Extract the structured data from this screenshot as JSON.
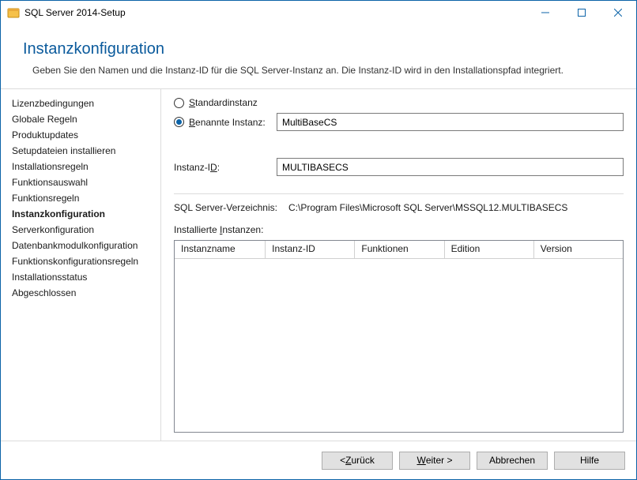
{
  "window": {
    "title": "SQL Server 2014-Setup"
  },
  "header": {
    "title": "Instanzkonfiguration",
    "subtitle": "Geben Sie den Namen und die Instanz-ID für die SQL Server-Instanz an. Die Instanz-ID wird in den Installationspfad integriert."
  },
  "sidebar": {
    "items": [
      "Lizenzbedingungen",
      "Globale Regeln",
      "Produktupdates",
      "Setupdateien installieren",
      "Installationsregeln",
      "Funktionsauswahl",
      "Funktionsregeln",
      "Instanzkonfiguration",
      "Serverkonfiguration",
      "Datenbankmodulkonfiguration",
      "Funktionskonfigurationsregeln",
      "Installationsstatus",
      "Abgeschlossen"
    ],
    "currentIndex": 7
  },
  "main": {
    "radio_default_pre": "",
    "radio_default_key": "S",
    "radio_default_post": "tandardinstanz",
    "radio_named_pre": "",
    "radio_named_key": "B",
    "radio_named_post": "enannte Instanz:",
    "named_value": "MultiBaseCS",
    "instance_id_label_pre": "Instanz-I",
    "instance_id_label_key": "D",
    "instance_id_label_post": ":",
    "instance_id_value": "MULTIBASECS",
    "dir_label": "SQL Server-Verzeichnis:",
    "dir_value": "C:\\Program Files\\Microsoft SQL Server\\MSSQL12.MULTIBASECS",
    "installed_label_pre": "Installierte ",
    "installed_label_key": "I",
    "installed_label_post": "nstanzen:",
    "grid": {
      "cols": [
        "Instanzname",
        "Instanz-ID",
        "Funktionen",
        "Edition",
        "Version"
      ]
    }
  },
  "footer": {
    "back_pre": "< ",
    "back_key": "Z",
    "back_post": "urück",
    "next_pre": "",
    "next_key": "W",
    "next_post": "eiter >",
    "cancel": "Abbrechen",
    "help": "Hilfe"
  }
}
